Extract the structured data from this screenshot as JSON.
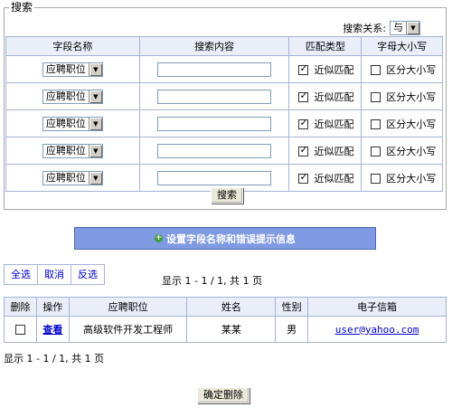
{
  "search": {
    "legend": "搜索",
    "relation_label": "搜索关系:",
    "relation_value": "与",
    "headers": [
      "字段名称",
      "搜索内容",
      "匹配类型",
      "字母大小写"
    ],
    "rows": [
      {
        "field": "应聘职位",
        "content": "",
        "fuzzy_label": "近似匹配",
        "fuzzy_checked": true,
        "case_label": "区分大小写",
        "case_checked": false
      },
      {
        "field": "应聘职位",
        "content": "",
        "fuzzy_label": "近似匹配",
        "fuzzy_checked": true,
        "case_label": "区分大小写",
        "case_checked": false
      },
      {
        "field": "应聘职位",
        "content": "",
        "fuzzy_label": "近似匹配",
        "fuzzy_checked": true,
        "case_label": "区分大小写",
        "case_checked": false
      },
      {
        "field": "应聘职位",
        "content": "",
        "fuzzy_label": "近似匹配",
        "fuzzy_checked": true,
        "case_label": "区分大小写",
        "case_checked": false
      },
      {
        "field": "应聘职位",
        "content": "",
        "fuzzy_label": "近似匹配",
        "fuzzy_checked": true,
        "case_label": "区分大小写",
        "case_checked": false
      }
    ],
    "submit_label": "搜索"
  },
  "banner": {
    "label": "设置字段名称和错误提示信息"
  },
  "selection": {
    "all": "全选",
    "cancel": "取消",
    "invert": "反选"
  },
  "pager_top": "显示 1 - 1 / 1, 共 1 页",
  "pager_bottom": "显示 1 - 1 / 1, 共 1 页",
  "results": {
    "headers": [
      "删除",
      "操作",
      "应聘职位",
      "姓名",
      "性别",
      "电子信箱"
    ],
    "rows": [
      {
        "checked": false,
        "action": "查看",
        "position": "高级软件开发工程师",
        "name": "某某",
        "gender": "男",
        "email": "user@yahoo.com"
      }
    ]
  },
  "confirm_delete": "确定删除"
}
